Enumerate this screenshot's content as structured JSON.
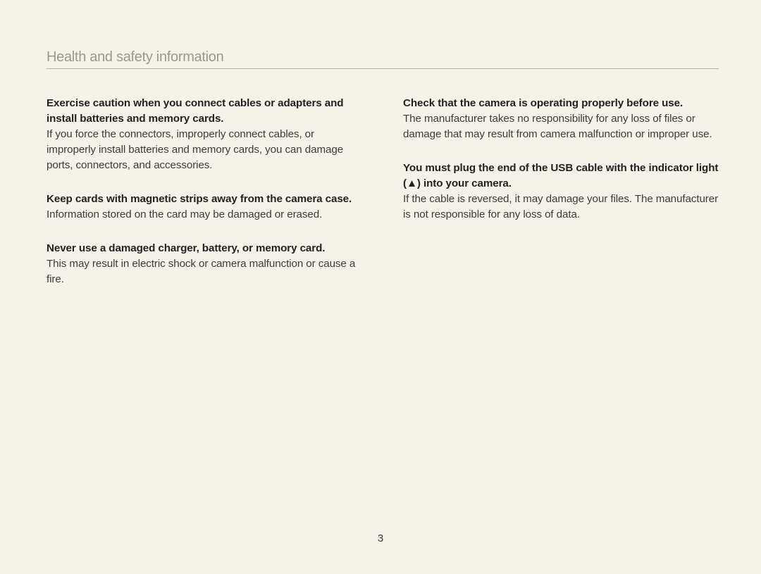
{
  "header": {
    "title": "Health and safety information"
  },
  "left_col": {
    "sections": [
      {
        "head": "Exercise caution when you connect cables or adapters and install batteries and memory cards.",
        "body": "If you force the connectors, improperly connect cables, or improperly install batteries and memory cards, you can damage ports, connectors, and accessories."
      },
      {
        "head": "Keep cards with magnetic strips away from the camera case.",
        "body": "Information stored on the card may be damaged or erased."
      },
      {
        "head": "Never use a damaged charger, battery, or memory card.",
        "body": "This may result in electric shock or camera malfunction or cause a fire."
      }
    ]
  },
  "right_col": {
    "sections": [
      {
        "head": "Check that the camera is operating properly before use.",
        "body": "The manufacturer takes no responsibility for any loss of files or damage that may result from camera malfunction or improper use."
      },
      {
        "head": "You must plug the end of the USB cable with the indicator light (▲) into your camera.",
        "body": "If the cable is reversed, it may damage your files. The manufacturer is not responsible for any loss of data."
      }
    ]
  },
  "page_number": "3"
}
